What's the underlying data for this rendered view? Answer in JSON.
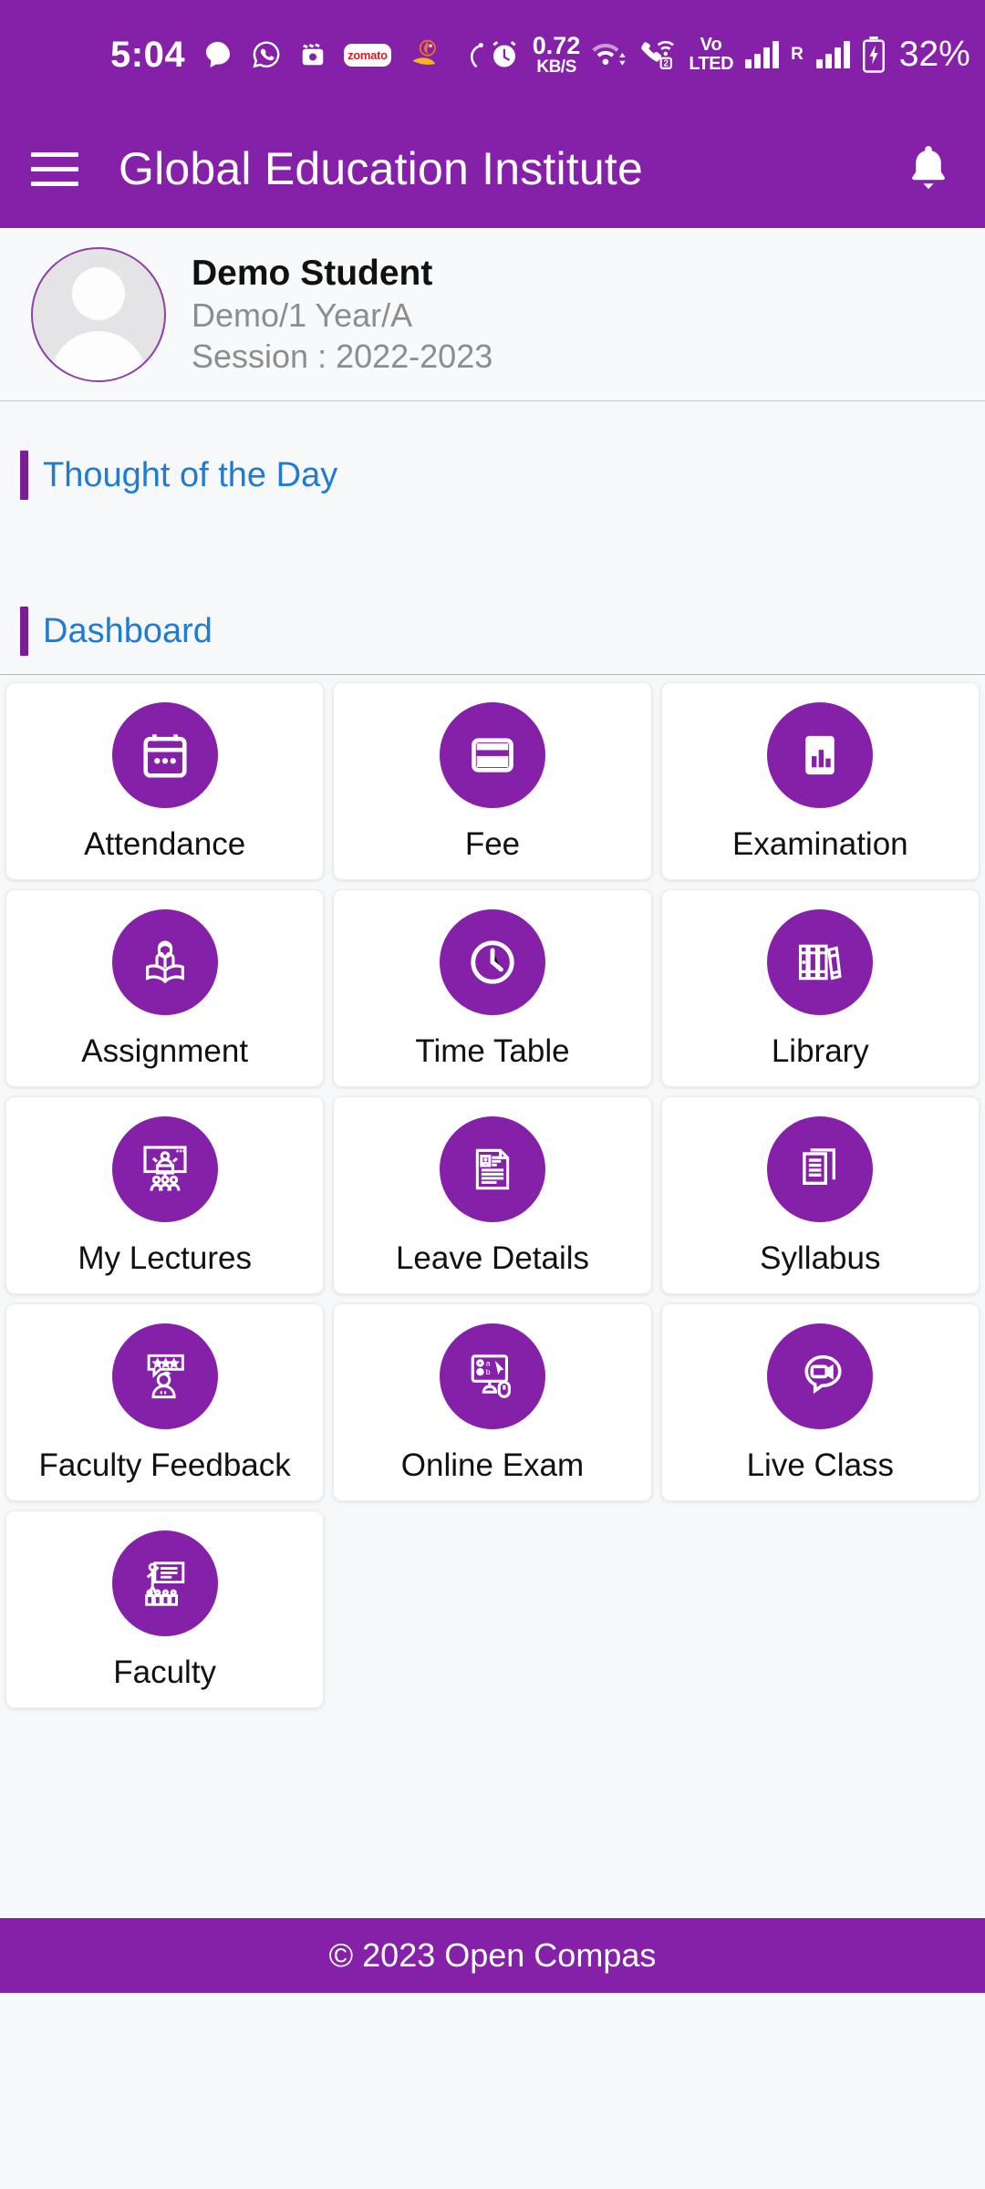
{
  "theme": {
    "primary_purple": "#8521A8",
    "accent_blue": "#1f7bd4",
    "section_bar_purple": "#7b1d96",
    "page_background": "#f7f8f9",
    "tile_background": "#ffffff"
  },
  "statusbar": {
    "clock": "5:04",
    "left_icons": [
      {
        "name": "chat-bubble-icon",
        "label": "Chat"
      },
      {
        "name": "whatsapp-icon",
        "label": "WhatsApp"
      },
      {
        "name": "media-clip-icon",
        "label": "Media"
      },
      {
        "name": "zomato-icon",
        "label": "zomato"
      },
      {
        "name": "app-orange-icon",
        "label": "App"
      },
      {
        "name": "do-not-disturb-moon-icon",
        "label": "Do Not Disturb"
      }
    ],
    "alarm_icon": "alarm-icon",
    "network_speed_value": "0.72",
    "network_speed_unit": "KB/S",
    "wifi_icon": "wifi-icon",
    "wifi_calling_icon": "wifi-calling-icon",
    "sim_badge": "2",
    "volte_line1": "Vo",
    "volte_line2": "LTED",
    "roaming_label": "R",
    "signal_bars_1": 4,
    "signal_bars_2": 4,
    "battery_icon": "battery-charging-icon",
    "battery_percent": "32%"
  },
  "appbar": {
    "menu_icon": "hamburger-menu-icon",
    "title": "Global Education Institute",
    "notification_icon": "bell-icon"
  },
  "profile": {
    "avatar_icon": "avatar-placeholder-icon",
    "name": "Demo Student",
    "class_info": "Demo/1 Year/A",
    "session": "Session : 2022-2023"
  },
  "sections": {
    "thought_of_the_day": {
      "title": "Thought of the Day",
      "content": ""
    },
    "dashboard": {
      "title": "Dashboard"
    }
  },
  "dashboard_tiles": [
    {
      "label": "Attendance",
      "icon": "calendar-icon"
    },
    {
      "label": "Fee",
      "icon": "credit-card-icon"
    },
    {
      "label": "Examination",
      "icon": "exam-chart-icon"
    },
    {
      "label": "Assignment",
      "icon": "student-reading-icon"
    },
    {
      "label": "Time Table",
      "icon": "clock-icon"
    },
    {
      "label": "Library",
      "icon": "books-shelf-icon"
    },
    {
      "label": "My Lectures",
      "icon": "lecture-presenter-icon"
    },
    {
      "label": "Leave Details",
      "icon": "leave-document-icon"
    },
    {
      "label": "Syllabus",
      "icon": "stacked-documents-icon"
    },
    {
      "label": "Faculty Feedback",
      "icon": "feedback-stars-icon"
    },
    {
      "label": "Online Exam",
      "icon": "monitor-exam-icon"
    },
    {
      "label": "Live Class",
      "icon": "video-chat-icon"
    },
    {
      "label": "Faculty",
      "icon": "teacher-board-icon"
    }
  ],
  "footer": {
    "copyright": "© 2023 Open Compas"
  }
}
